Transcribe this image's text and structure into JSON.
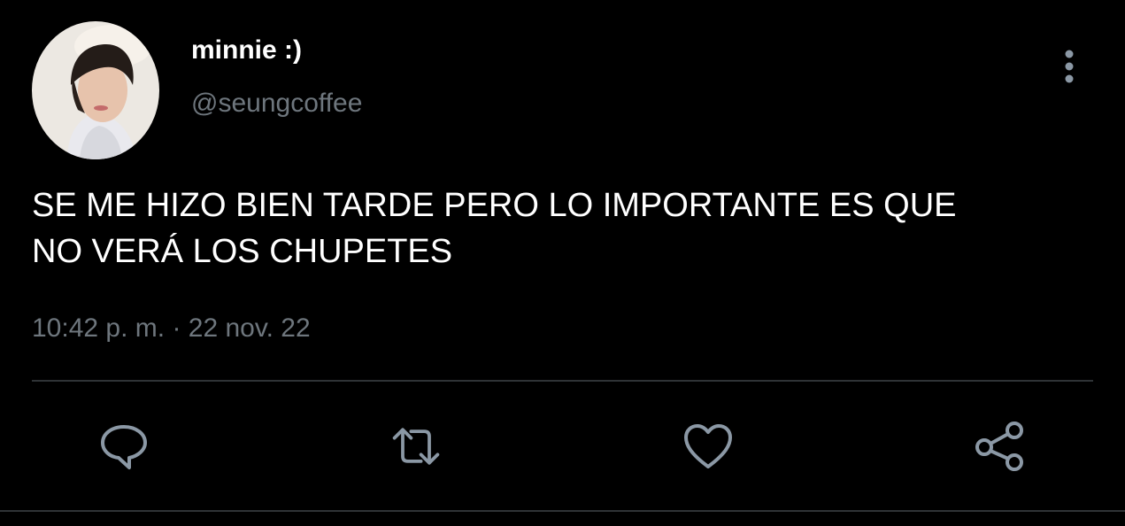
{
  "user": {
    "display_name": "minnie :)",
    "handle": "@seungcoffee"
  },
  "tweet": {
    "text_line1": "SE ME HIZO BIEN TARDE PERO LO IMPORTANTE ES QUE",
    "text_line2": "NO VERÁ LOS CHUPETES",
    "time": "10:42 p. m.",
    "separator": "·",
    "date": "22 nov. 22"
  },
  "actions": {
    "reply_icon": "reply-icon",
    "retweet_icon": "retweet-icon",
    "like_icon": "heart-icon",
    "share_icon": "share-icon"
  },
  "colors": {
    "background": "#000000",
    "text_primary": "#ffffff",
    "text_secondary": "#6e767d",
    "icon": "#8b98a5",
    "divider": "#2f3336"
  }
}
